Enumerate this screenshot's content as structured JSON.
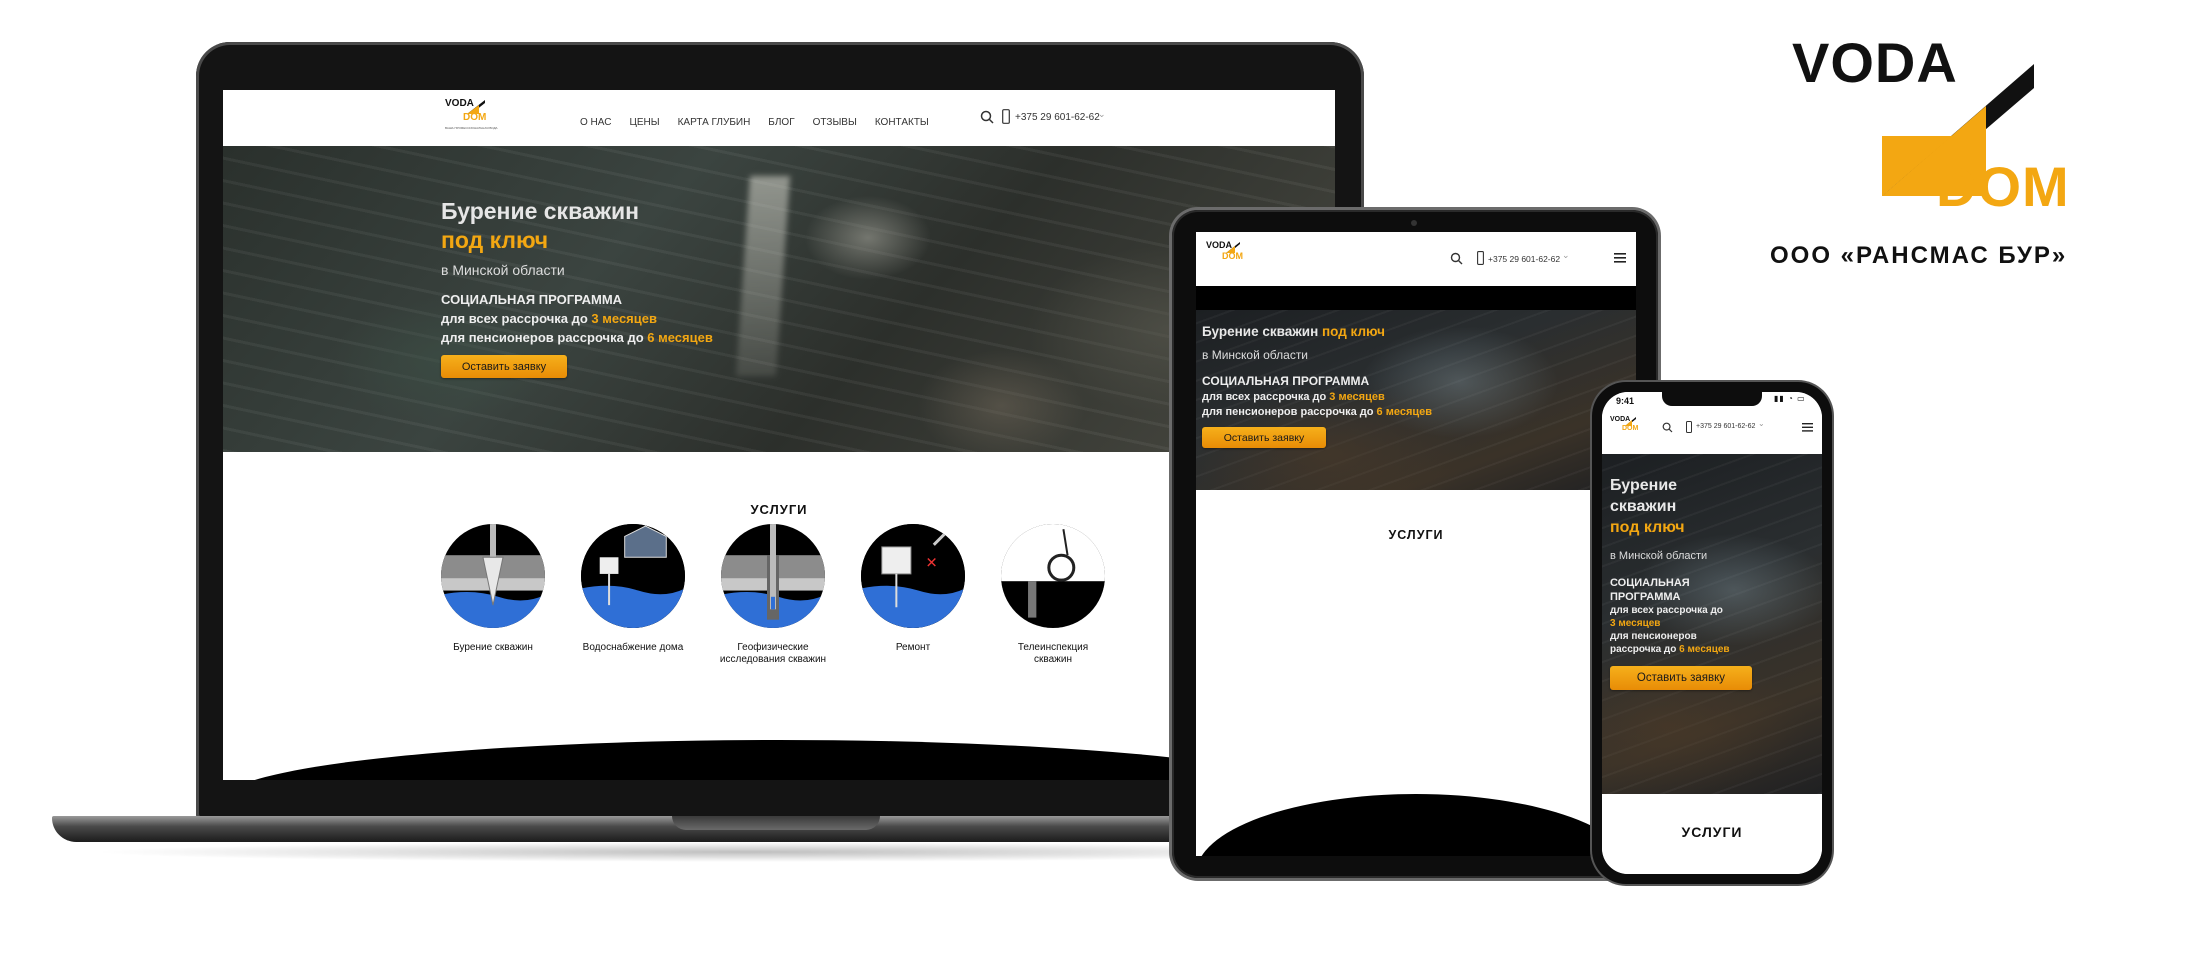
{
  "brand": {
    "logo_top": "VODA",
    "logo_bottom": "DOM",
    "logo_tagline": "ВАША ПРОФЕССИОНАЛЬНАЯ ВОДА",
    "company": "ООО «РАНСМАС БУР»",
    "colors": {
      "accent": "#f3a712",
      "dark": "#111111"
    }
  },
  "nav": {
    "items": [
      "О НАС",
      "ЦЕНЫ",
      "КАРТА ГЛУБИН",
      "БЛОГ",
      "ОТЗЫВЫ",
      "КОНТАКТЫ"
    ],
    "phone": "+375 29 601-62-62",
    "search_icon": "search-icon",
    "phone_icon": "phone-icon",
    "menu_icon": "hamburger-icon"
  },
  "hero": {
    "title_line1": "Бурение скважин",
    "title_line2": "под ключ",
    "title_full_prefix": "Бурение скважин",
    "title_short_a": "Бурение",
    "title_short_b": "скважин",
    "region": "в Минской области",
    "program_title": "СОЦИАЛЬНАЯ ПРОГРАММА",
    "program_title_a": "СОЦИАЛЬНАЯ",
    "program_title_b": "ПРОГРАММА",
    "line1_prefix": "для всех рассрочка до",
    "line1_value": "3 месяцев",
    "line2_prefix": "для пенсионеров рассрочка до",
    "line2_prefix_a": "для пенсионеров",
    "line2_prefix_b": "рассрочка до",
    "line2_value": "6 месяцев",
    "cta": "Оставить заявку"
  },
  "services": {
    "title": "УСЛУГИ",
    "items": [
      {
        "label": "Бурение скважин",
        "icon": "drill-icon"
      },
      {
        "label": "Водоснабжение дома",
        "label_a": "Водоснабжение",
        "label_b": "дома",
        "icon": "house-water-icon"
      },
      {
        "label_a": "Геофизические",
        "label_b": "исследования скважин",
        "label_c": "исследования",
        "label_d": "скважин",
        "icon": "well-probe-icon"
      },
      {
        "label": "Ремонт",
        "icon": "repair-icon"
      },
      {
        "label_a": "Телеинспекция",
        "label_b": "скважин",
        "icon": "camera-reel-icon"
      }
    ]
  },
  "phone_status": {
    "time": "9:41"
  }
}
